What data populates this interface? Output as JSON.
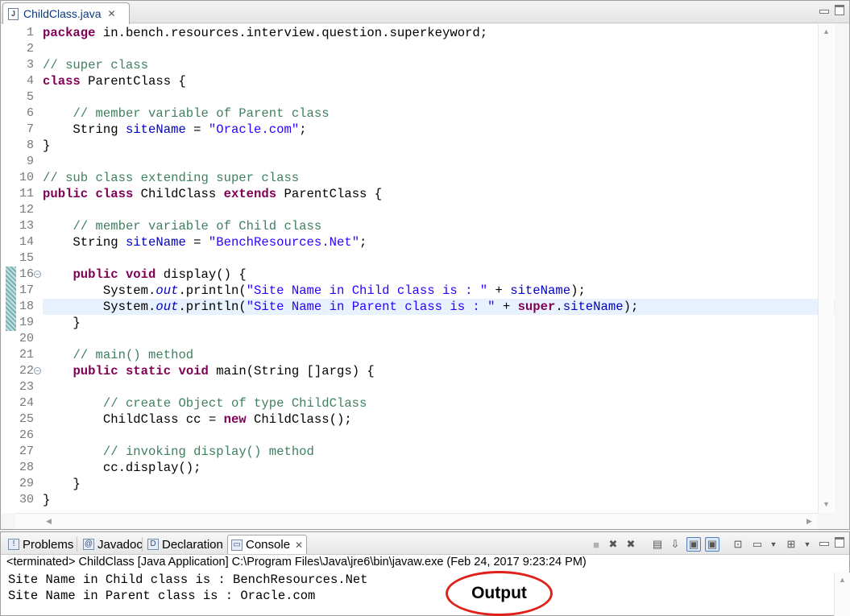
{
  "editor": {
    "tab_label": "ChildClass.java",
    "file_icon_glyph": "J",
    "close_glyph": "✕",
    "active_line": 18,
    "changed_lines": [
      16,
      19
    ],
    "folded_lines": [
      16,
      22
    ],
    "lines": [
      [
        [
          "kw",
          "package"
        ],
        [
          "t",
          " in.bench.resources.interview.question.superkeyword;"
        ]
      ],
      [],
      [
        [
          "cm",
          "// super class"
        ]
      ],
      [
        [
          "kw",
          "class"
        ],
        [
          "t",
          " ParentClass {"
        ]
      ],
      [],
      [
        [
          "t",
          "    "
        ],
        [
          "cm",
          "// member variable of Parent class"
        ]
      ],
      [
        [
          "t",
          "    String "
        ],
        [
          "fld",
          "siteName"
        ],
        [
          "t",
          " = "
        ],
        [
          "str",
          "\"Oracle.com\""
        ],
        [
          "t",
          ";"
        ]
      ],
      [
        [
          "t",
          "}"
        ]
      ],
      [],
      [
        [
          "cm",
          "// sub class extending super class"
        ]
      ],
      [
        [
          "kw",
          "public"
        ],
        [
          "t",
          " "
        ],
        [
          "kw",
          "class"
        ],
        [
          "t",
          " ChildClass "
        ],
        [
          "kw",
          "extends"
        ],
        [
          "t",
          " ParentClass {"
        ]
      ],
      [],
      [
        [
          "t",
          "    "
        ],
        [
          "cm",
          "// member variable of Child class"
        ]
      ],
      [
        [
          "t",
          "    String "
        ],
        [
          "fld",
          "siteName"
        ],
        [
          "t",
          " = "
        ],
        [
          "str",
          "\"BenchResources.Net\""
        ],
        [
          "t",
          ";"
        ]
      ],
      [],
      [
        [
          "t",
          "    "
        ],
        [
          "kw",
          "public"
        ],
        [
          "t",
          " "
        ],
        [
          "kw",
          "void"
        ],
        [
          "t",
          " display() {"
        ]
      ],
      [
        [
          "t",
          "        System."
        ],
        [
          "st",
          "out"
        ],
        [
          "t",
          ".println("
        ],
        [
          "str",
          "\"Site Name in Child class is : \""
        ],
        [
          "t",
          " + "
        ],
        [
          "fld",
          "siteName"
        ],
        [
          "t",
          ");"
        ]
      ],
      [
        [
          "t",
          "        System."
        ],
        [
          "st",
          "out"
        ],
        [
          "t",
          ".println("
        ],
        [
          "str",
          "\"Site Name in Parent class is : \""
        ],
        [
          "t",
          " + "
        ],
        [
          "kw",
          "super"
        ],
        [
          "t",
          "."
        ],
        [
          "fld",
          "siteName"
        ],
        [
          "t",
          ");"
        ]
      ],
      [
        [
          "t",
          "    }"
        ]
      ],
      [],
      [
        [
          "t",
          "    "
        ],
        [
          "cm",
          "// main() method"
        ]
      ],
      [
        [
          "t",
          "    "
        ],
        [
          "kw",
          "public"
        ],
        [
          "t",
          " "
        ],
        [
          "kw",
          "static"
        ],
        [
          "t",
          " "
        ],
        [
          "kw",
          "void"
        ],
        [
          "t",
          " main(String []args) {"
        ]
      ],
      [],
      [
        [
          "t",
          "        "
        ],
        [
          "cm",
          "// create Object of type ChildClass"
        ]
      ],
      [
        [
          "t",
          "        ChildClass cc = "
        ],
        [
          "kw",
          "new"
        ],
        [
          "t",
          " ChildClass();"
        ]
      ],
      [],
      [
        [
          "t",
          "        "
        ],
        [
          "cm",
          "// invoking display() method"
        ]
      ],
      [
        [
          "t",
          "        cc.display();"
        ]
      ],
      [
        [
          "t",
          "    }"
        ]
      ],
      [
        [
          "t",
          "}"
        ]
      ]
    ]
  },
  "console": {
    "tabs": [
      {
        "label": "Problems",
        "icon": "problems-icon",
        "glyph": "!"
      },
      {
        "label": "Javadoc",
        "icon": "javadoc-icon",
        "glyph": "@"
      },
      {
        "label": "Declaration",
        "icon": "declaration-icon",
        "glyph": "D"
      },
      {
        "label": "Console",
        "icon": "console-icon",
        "glyph": "▭"
      }
    ],
    "close_glyph": "✕",
    "status": "<terminated> ChildClass [Java Application] C:\\Program Files\\Java\\jre6\\bin\\javaw.exe (Feb 24, 2017 9:23:24 PM)",
    "output_lines": [
      "Site Name in Child class is : BenchResources.Net",
      "Site Name in Parent class is : Oracle.com"
    ],
    "toolbar_icons": [
      "terminate-icon",
      "remove-launch-icon",
      "remove-all-terminated-icon",
      "clear-console-icon",
      "scroll-lock-icon",
      "show-on-stdout-icon",
      "show-on-stderr-icon",
      "pin-console-icon",
      "display-selected-console-icon",
      "open-console-icon",
      "view-menu-icon",
      "minimize-icon",
      "maximize-icon"
    ]
  },
  "annotation": {
    "label": "Output",
    "color": "#e0201a"
  },
  "colors": {
    "keyword": "#7f0055",
    "comment": "#3f7f5f",
    "string": "#2a00ff",
    "field": "#0000c0",
    "current_line": "#e8f2fe"
  }
}
